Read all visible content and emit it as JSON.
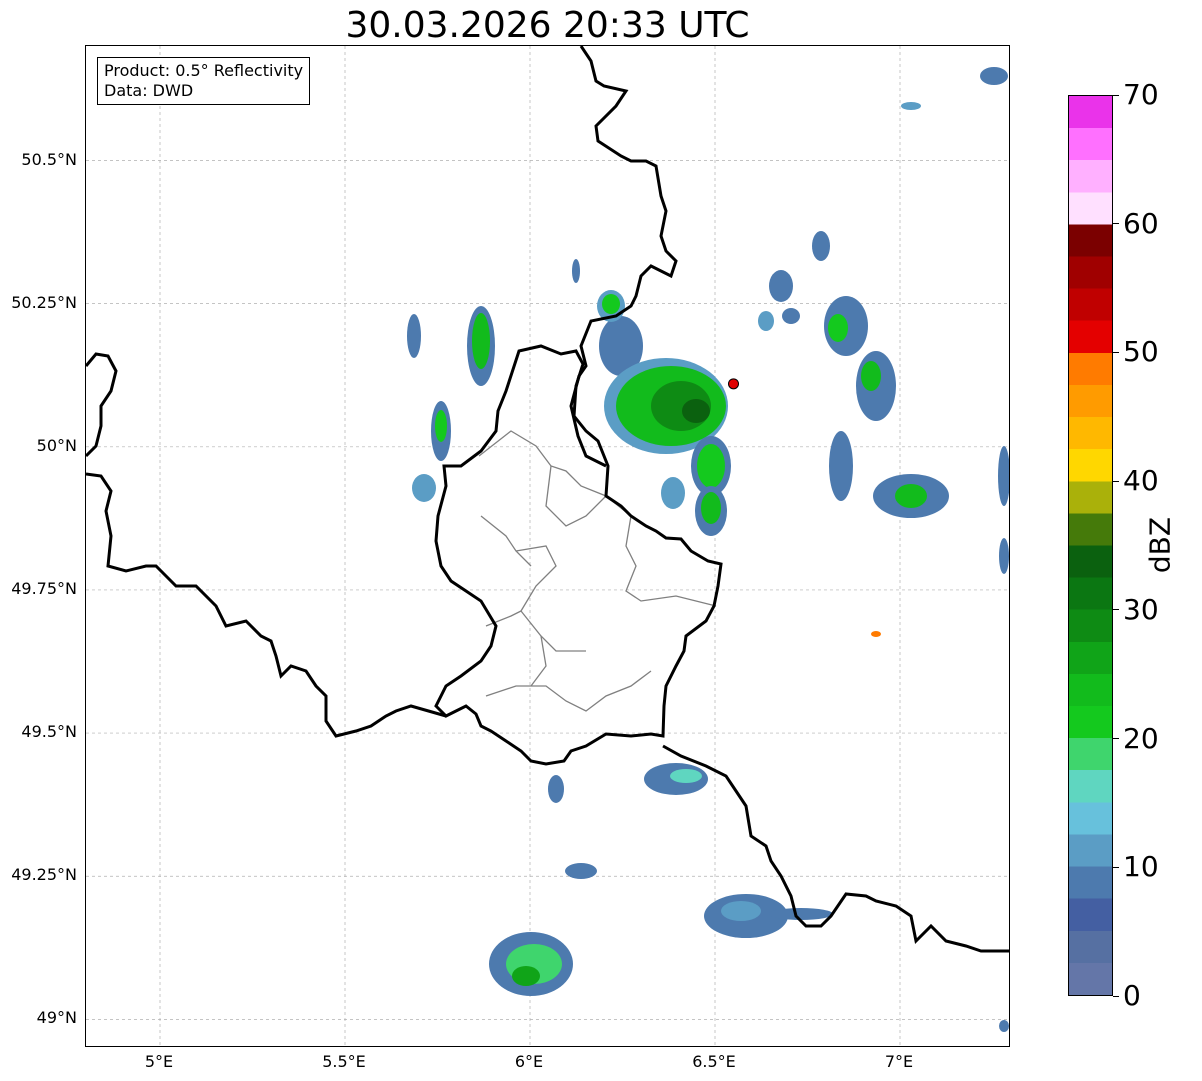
{
  "title": "30.03.2026 20:33 UTC",
  "info": {
    "product": "Product: 0.5° Reflectivity",
    "data": "Data: DWD"
  },
  "map": {
    "lon_range": [
      4.8,
      7.3
    ],
    "lat_range": [
      48.95,
      50.7
    ],
    "lat_ticks": [
      {
        "value": 49.0,
        "label": "49°N"
      },
      {
        "value": 49.25,
        "label": "49.25°N"
      },
      {
        "value": 49.5,
        "label": "49.5°N"
      },
      {
        "value": 49.75,
        "label": "49.75°N"
      },
      {
        "value": 50.0,
        "label": "50°N"
      },
      {
        "value": 50.25,
        "label": "50.25°N"
      },
      {
        "value": 50.5,
        "label": "50.5°N"
      }
    ],
    "lon_ticks": [
      {
        "value": 5.0,
        "label": "5°E"
      },
      {
        "value": 5.5,
        "label": "5.5°E"
      },
      {
        "value": 6.0,
        "label": "6°E"
      },
      {
        "value": 6.5,
        "label": "6.5°E"
      },
      {
        "value": 7.0,
        "label": "7°E"
      }
    ],
    "grid": true,
    "radar_site": {
      "lon": 6.55,
      "lat": 50.11
    }
  },
  "colorbar": {
    "unit": "dBZ",
    "min": 0,
    "max": 70,
    "ticks": [
      0,
      10,
      20,
      30,
      40,
      50,
      60,
      70
    ],
    "colors": [
      "#6476a8",
      "#5670a2",
      "#445fa2",
      "#4d7aae",
      "#5b9dc5",
      "#67c1dc",
      "#5fd6c0",
      "#3fd56d",
      "#14c91e",
      "#12bb1c",
      "#10a418",
      "#0e8b14",
      "#0b7712",
      "#0b610f",
      "#457a0a",
      "#aab10a",
      "#ffd700",
      "#ffb800",
      "#ff9b00",
      "#ff7b00",
      "#e40000",
      "#c00000",
      "#a00000",
      "#7b0000",
      "#ffe0ff",
      "#ffb0ff",
      "#ff70ff",
      "#ea33ea"
    ]
  }
}
